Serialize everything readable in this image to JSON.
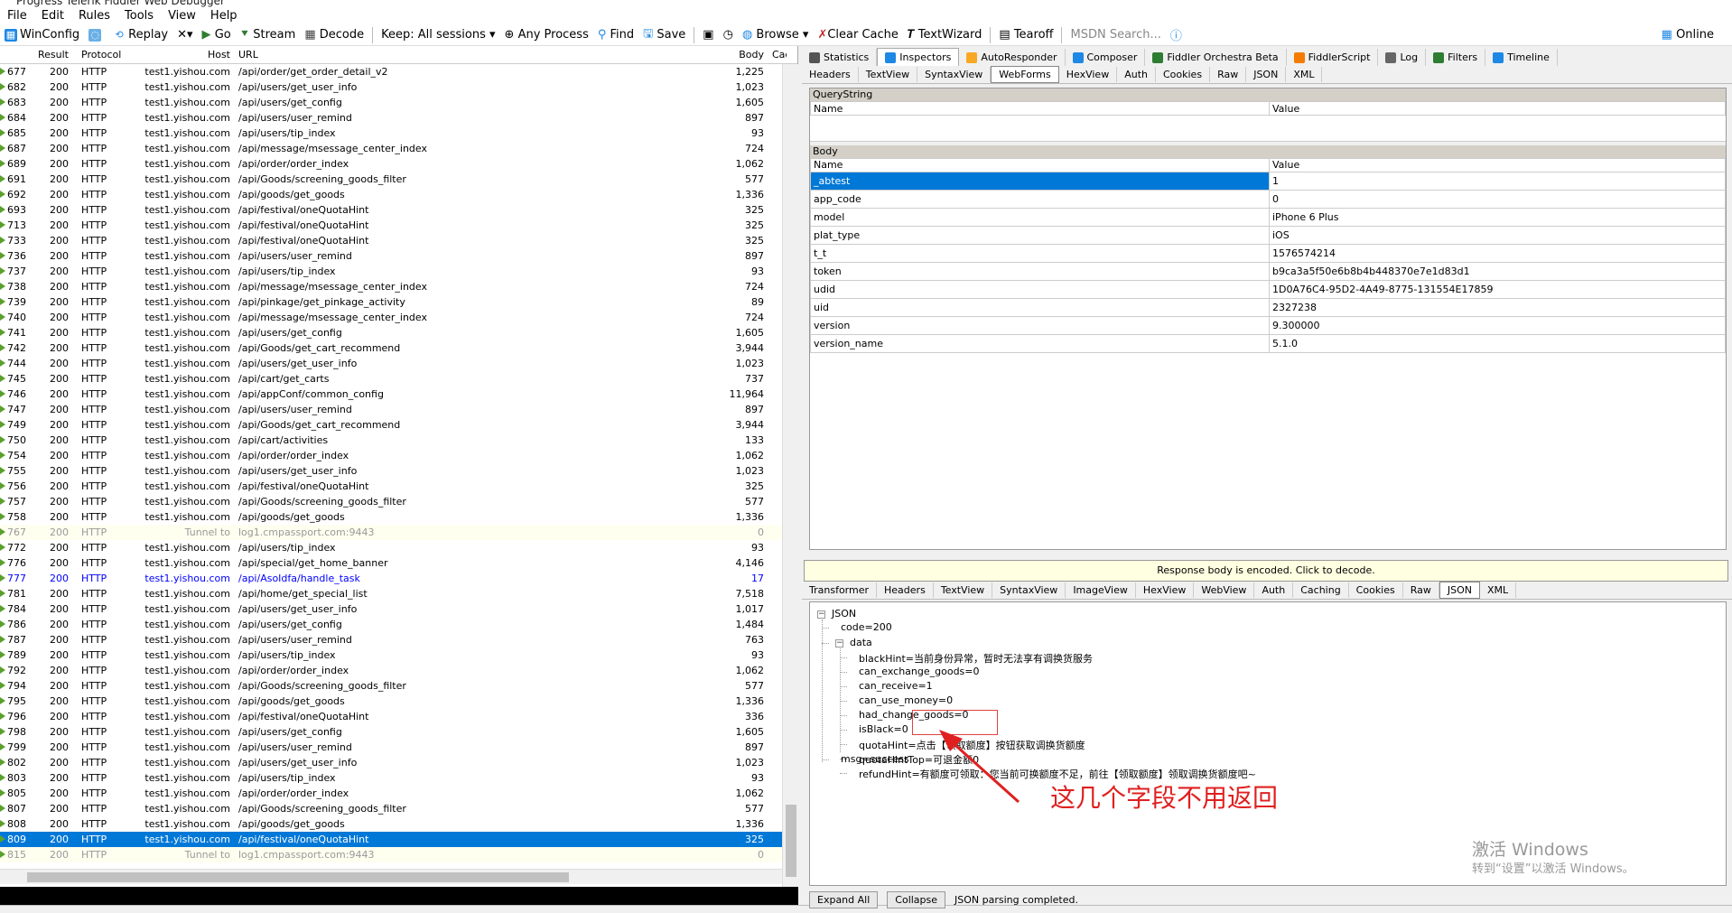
{
  "window": {
    "title": "Progress Telerik Fiddler Web Debugger"
  },
  "menu": [
    "File",
    "Edit",
    "Rules",
    "Tools",
    "View",
    "Help"
  ],
  "toolbar": {
    "winconfig": "WinConfig",
    "replay": "Replay",
    "go": "Go",
    "stream": "Stream",
    "decode": "Decode",
    "keep": "Keep: All sessions",
    "anyprocess": "Any Process",
    "find": "Find",
    "save": "Save",
    "browse": "Browse",
    "clearcache": "Clear Cache",
    "textwizard": "TextWizard",
    "tearoff": "Tearoff",
    "msdn": "MSDN Search...",
    "online": "Online"
  },
  "grid": {
    "headers": {
      "result": "Result",
      "protocol": "Protocol",
      "host": "Host",
      "url": "URL",
      "body": "Body",
      "cache": "Cac"
    },
    "rows": [
      [
        "677",
        "200",
        "HTTP",
        "test1.yishou.com",
        "/api/order/get_order_detail_v2",
        "1,225"
      ],
      [
        "682",
        "200",
        "HTTP",
        "test1.yishou.com",
        "/api/users/get_user_info",
        "1,023"
      ],
      [
        "683",
        "200",
        "HTTP",
        "test1.yishou.com",
        "/api/users/get_config",
        "1,605"
      ],
      [
        "684",
        "200",
        "HTTP",
        "test1.yishou.com",
        "/api/users/user_remind",
        "897"
      ],
      [
        "685",
        "200",
        "HTTP",
        "test1.yishou.com",
        "/api/users/tip_index",
        "93"
      ],
      [
        "687",
        "200",
        "HTTP",
        "test1.yishou.com",
        "/api/message/msessage_center_index",
        "724"
      ],
      [
        "689",
        "200",
        "HTTP",
        "test1.yishou.com",
        "/api/order/order_index",
        "1,062"
      ],
      [
        "691",
        "200",
        "HTTP",
        "test1.yishou.com",
        "/api/Goods/screening_goods_filter",
        "577"
      ],
      [
        "692",
        "200",
        "HTTP",
        "test1.yishou.com",
        "/api/goods/get_goods",
        "1,336"
      ],
      [
        "693",
        "200",
        "HTTP",
        "test1.yishou.com",
        "/api/festival/oneQuotaHint",
        "325"
      ],
      [
        "713",
        "200",
        "HTTP",
        "test1.yishou.com",
        "/api/festival/oneQuotaHint",
        "325"
      ],
      [
        "733",
        "200",
        "HTTP",
        "test1.yishou.com",
        "/api/festival/oneQuotaHint",
        "325"
      ],
      [
        "736",
        "200",
        "HTTP",
        "test1.yishou.com",
        "/api/users/user_remind",
        "897"
      ],
      [
        "737",
        "200",
        "HTTP",
        "test1.yishou.com",
        "/api/users/tip_index",
        "93"
      ],
      [
        "738",
        "200",
        "HTTP",
        "test1.yishou.com",
        "/api/message/msessage_center_index",
        "724"
      ],
      [
        "739",
        "200",
        "HTTP",
        "test1.yishou.com",
        "/api/pinkage/get_pinkage_activity",
        "89"
      ],
      [
        "740",
        "200",
        "HTTP",
        "test1.yishou.com",
        "/api/message/msessage_center_index",
        "724"
      ],
      [
        "741",
        "200",
        "HTTP",
        "test1.yishou.com",
        "/api/users/get_config",
        "1,605"
      ],
      [
        "742",
        "200",
        "HTTP",
        "test1.yishou.com",
        "/api/Goods/get_cart_recommend",
        "3,944"
      ],
      [
        "744",
        "200",
        "HTTP",
        "test1.yishou.com",
        "/api/users/get_user_info",
        "1,023"
      ],
      [
        "745",
        "200",
        "HTTP",
        "test1.yishou.com",
        "/api/cart/get_carts",
        "737"
      ],
      [
        "746",
        "200",
        "HTTP",
        "test1.yishou.com",
        "/api/appConf/common_config",
        "11,964"
      ],
      [
        "747",
        "200",
        "HTTP",
        "test1.yishou.com",
        "/api/users/user_remind",
        "897"
      ],
      [
        "749",
        "200",
        "HTTP",
        "test1.yishou.com",
        "/api/Goods/get_cart_recommend",
        "3,944"
      ],
      [
        "750",
        "200",
        "HTTP",
        "test1.yishou.com",
        "/api/cart/activities",
        "133"
      ],
      [
        "754",
        "200",
        "HTTP",
        "test1.yishou.com",
        "/api/order/order_index",
        "1,062"
      ],
      [
        "755",
        "200",
        "HTTP",
        "test1.yishou.com",
        "/api/users/get_user_info",
        "1,023"
      ],
      [
        "756",
        "200",
        "HTTP",
        "test1.yishou.com",
        "/api/festival/oneQuotaHint",
        "325"
      ],
      [
        "757",
        "200",
        "HTTP",
        "test1.yishou.com",
        "/api/Goods/screening_goods_filter",
        "577"
      ],
      [
        "758",
        "200",
        "HTTP",
        "test1.yishou.com",
        "/api/goods/get_goods",
        "1,336"
      ],
      [
        "767",
        "200",
        "HTTP",
        "Tunnel to",
        "log1.cmpassport.com:9443",
        "0"
      ],
      [
        "772",
        "200",
        "HTTP",
        "test1.yishou.com",
        "/api/users/tip_index",
        "93"
      ],
      [
        "776",
        "200",
        "HTTP",
        "test1.yishou.com",
        "/api/special/get_home_banner",
        "4,146"
      ],
      [
        "777",
        "200",
        "HTTP",
        "test1.yishou.com",
        "/api/AsoIdfa/handle_task",
        "17"
      ],
      [
        "781",
        "200",
        "HTTP",
        "test1.yishou.com",
        "/api/home/get_special_list",
        "7,518"
      ],
      [
        "784",
        "200",
        "HTTP",
        "test1.yishou.com",
        "/api/users/get_user_info",
        "1,017"
      ],
      [
        "786",
        "200",
        "HTTP",
        "test1.yishou.com",
        "/api/users/get_config",
        "1,484"
      ],
      [
        "787",
        "200",
        "HTTP",
        "test1.yishou.com",
        "/api/users/user_remind",
        "763"
      ],
      [
        "789",
        "200",
        "HTTP",
        "test1.yishou.com",
        "/api/users/tip_index",
        "93"
      ],
      [
        "792",
        "200",
        "HTTP",
        "test1.yishou.com",
        "/api/order/order_index",
        "1,062"
      ],
      [
        "794",
        "200",
        "HTTP",
        "test1.yishou.com",
        "/api/Goods/screening_goods_filter",
        "577"
      ],
      [
        "795",
        "200",
        "HTTP",
        "test1.yishou.com",
        "/api/goods/get_goods",
        "1,336"
      ],
      [
        "796",
        "200",
        "HTTP",
        "test1.yishou.com",
        "/api/festival/oneQuotaHint",
        "336"
      ],
      [
        "798",
        "200",
        "HTTP",
        "test1.yishou.com",
        "/api/users/get_config",
        "1,605"
      ],
      [
        "799",
        "200",
        "HTTP",
        "test1.yishou.com",
        "/api/users/user_remind",
        "897"
      ],
      [
        "802",
        "200",
        "HTTP",
        "test1.yishou.com",
        "/api/users/get_user_info",
        "1,023"
      ],
      [
        "803",
        "200",
        "HTTP",
        "test1.yishou.com",
        "/api/users/tip_index",
        "93"
      ],
      [
        "805",
        "200",
        "HTTP",
        "test1.yishou.com",
        "/api/order/order_index",
        "1,062"
      ],
      [
        "807",
        "200",
        "HTTP",
        "test1.yishou.com",
        "/api/Goods/screening_goods_filter",
        "577"
      ],
      [
        "808",
        "200",
        "HTTP",
        "test1.yishou.com",
        "/api/goods/get_goods",
        "1,336"
      ],
      [
        "809",
        "200",
        "HTTP",
        "test1.yishou.com",
        "/api/festival/oneQuotaHint",
        "325"
      ],
      [
        "815",
        "200",
        "HTTP",
        "Tunnel to",
        "log1.cmpassport.com:9443",
        "0"
      ]
    ],
    "tunnel_rows": [
      "767",
      "815"
    ],
    "blue_rows": [
      "777"
    ],
    "selected_row": "809"
  },
  "inspector": {
    "top_tabs": [
      "Statistics",
      "Inspectors",
      "AutoResponder",
      "Composer",
      "Fiddler Orchestra Beta",
      "FiddlerScript",
      "Log",
      "Filters",
      "Timeline"
    ],
    "req_tabs": [
      "Headers",
      "TextView",
      "SyntaxView",
      "WebForms",
      "HexView",
      "Auth",
      "Cookies",
      "Raw",
      "JSON",
      "XML"
    ],
    "querystring_label": "QueryString",
    "body_label": "Body",
    "name_col": "Name",
    "value_col": "Value",
    "body_rows": [
      [
        "_abtest",
        "1"
      ],
      [
        "app_code",
        "0"
      ],
      [
        "model",
        "iPhone 6 Plus"
      ],
      [
        "plat_type",
        "iOS"
      ],
      [
        "t_t",
        "1576574214"
      ],
      [
        "token",
        "b9ca3a5f50e6b8b4b448370e7e1d83d1"
      ],
      [
        "udid",
        "1D0A76C4-95D2-4A49-8775-131554E17859"
      ],
      [
        "uid",
        "2327238"
      ],
      [
        "version",
        "9.300000"
      ],
      [
        "version_name",
        "5.1.0"
      ]
    ],
    "encoded_notice": "Response body is encoded. Click to decode.",
    "resp_tabs": [
      "Transformer",
      "Headers",
      "TextView",
      "SyntaxView",
      "ImageView",
      "HexView",
      "WebView",
      "Auth",
      "Caching",
      "Cookies",
      "Raw",
      "JSON",
      "XML"
    ],
    "json_tree": {
      "root": "JSON",
      "code": "code=200",
      "data": "data",
      "children": [
        "blackHint=当前身份异常，暂时无法享有调换货服务",
        "can_exchange_goods=0",
        "can_receive=1",
        "can_use_money=0",
        "had_change_goods=0",
        "isBlack=0",
        "quotaHint=点击【领取额度】按钮获取调换货额度",
        "quotaHintTop=可退金额0",
        "refundHint=有额度可领取：您当前可换额度不足，前往【领取额度】领取调换货额度吧~"
      ],
      "msg": "msg=success"
    },
    "expand_all": "Expand All",
    "collapse": "Collapse",
    "parse_status": "JSON parsing completed."
  },
  "annotation": "这几个字段不用返回",
  "watermark": {
    "line1": "激活 Windows",
    "line2": "转到“设置”以激活 Windows。"
  },
  "colors": {
    "selection": "#0078d7",
    "annotation": "#e02020"
  }
}
